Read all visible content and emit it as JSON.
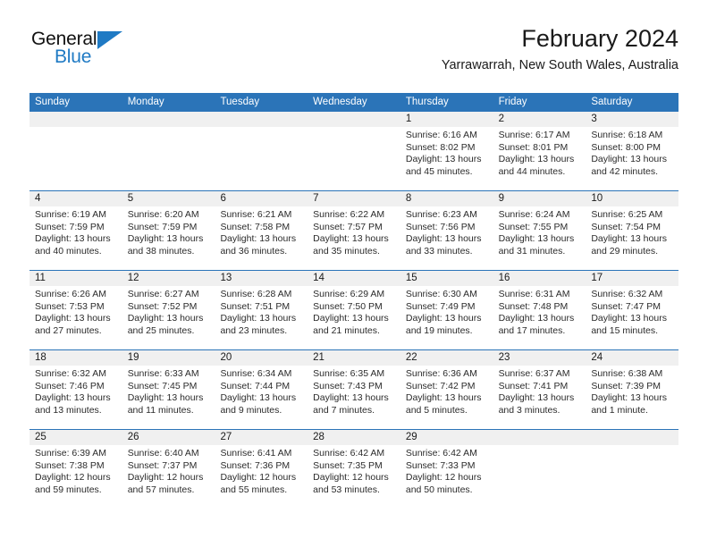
{
  "logo": {
    "word1": "General",
    "word2": "Blue",
    "blue": "#1f7ac4"
  },
  "header": {
    "title": "February 2024",
    "subtitle": "Yarrawarrah, New South Wales, Australia"
  },
  "theme": {
    "header_blue": "#2b74b8",
    "daynum_band": "#f0f0f0"
  },
  "calendar": {
    "weekday_headers": [
      "Sunday",
      "Monday",
      "Tuesday",
      "Wednesday",
      "Thursday",
      "Friday",
      "Saturday"
    ],
    "weeks": [
      [
        {
          "day": "",
          "lines": []
        },
        {
          "day": "",
          "lines": []
        },
        {
          "day": "",
          "lines": []
        },
        {
          "day": "",
          "lines": []
        },
        {
          "day": "1",
          "lines": [
            "Sunrise: 6:16 AM",
            "Sunset: 8:02 PM",
            "Daylight: 13 hours",
            "and 45 minutes."
          ]
        },
        {
          "day": "2",
          "lines": [
            "Sunrise: 6:17 AM",
            "Sunset: 8:01 PM",
            "Daylight: 13 hours",
            "and 44 minutes."
          ]
        },
        {
          "day": "3",
          "lines": [
            "Sunrise: 6:18 AM",
            "Sunset: 8:00 PM",
            "Daylight: 13 hours",
            "and 42 minutes."
          ]
        }
      ],
      [
        {
          "day": "4",
          "lines": [
            "Sunrise: 6:19 AM",
            "Sunset: 7:59 PM",
            "Daylight: 13 hours",
            "and 40 minutes."
          ]
        },
        {
          "day": "5",
          "lines": [
            "Sunrise: 6:20 AM",
            "Sunset: 7:59 PM",
            "Daylight: 13 hours",
            "and 38 minutes."
          ]
        },
        {
          "day": "6",
          "lines": [
            "Sunrise: 6:21 AM",
            "Sunset: 7:58 PM",
            "Daylight: 13 hours",
            "and 36 minutes."
          ]
        },
        {
          "day": "7",
          "lines": [
            "Sunrise: 6:22 AM",
            "Sunset: 7:57 PM",
            "Daylight: 13 hours",
            "and 35 minutes."
          ]
        },
        {
          "day": "8",
          "lines": [
            "Sunrise: 6:23 AM",
            "Sunset: 7:56 PM",
            "Daylight: 13 hours",
            "and 33 minutes."
          ]
        },
        {
          "day": "9",
          "lines": [
            "Sunrise: 6:24 AM",
            "Sunset: 7:55 PM",
            "Daylight: 13 hours",
            "and 31 minutes."
          ]
        },
        {
          "day": "10",
          "lines": [
            "Sunrise: 6:25 AM",
            "Sunset: 7:54 PM",
            "Daylight: 13 hours",
            "and 29 minutes."
          ]
        }
      ],
      [
        {
          "day": "11",
          "lines": [
            "Sunrise: 6:26 AM",
            "Sunset: 7:53 PM",
            "Daylight: 13 hours",
            "and 27 minutes."
          ]
        },
        {
          "day": "12",
          "lines": [
            "Sunrise: 6:27 AM",
            "Sunset: 7:52 PM",
            "Daylight: 13 hours",
            "and 25 minutes."
          ]
        },
        {
          "day": "13",
          "lines": [
            "Sunrise: 6:28 AM",
            "Sunset: 7:51 PM",
            "Daylight: 13 hours",
            "and 23 minutes."
          ]
        },
        {
          "day": "14",
          "lines": [
            "Sunrise: 6:29 AM",
            "Sunset: 7:50 PM",
            "Daylight: 13 hours",
            "and 21 minutes."
          ]
        },
        {
          "day": "15",
          "lines": [
            "Sunrise: 6:30 AM",
            "Sunset: 7:49 PM",
            "Daylight: 13 hours",
            "and 19 minutes."
          ]
        },
        {
          "day": "16",
          "lines": [
            "Sunrise: 6:31 AM",
            "Sunset: 7:48 PM",
            "Daylight: 13 hours",
            "and 17 minutes."
          ]
        },
        {
          "day": "17",
          "lines": [
            "Sunrise: 6:32 AM",
            "Sunset: 7:47 PM",
            "Daylight: 13 hours",
            "and 15 minutes."
          ]
        }
      ],
      [
        {
          "day": "18",
          "lines": [
            "Sunrise: 6:32 AM",
            "Sunset: 7:46 PM",
            "Daylight: 13 hours",
            "and 13 minutes."
          ]
        },
        {
          "day": "19",
          "lines": [
            "Sunrise: 6:33 AM",
            "Sunset: 7:45 PM",
            "Daylight: 13 hours",
            "and 11 minutes."
          ]
        },
        {
          "day": "20",
          "lines": [
            "Sunrise: 6:34 AM",
            "Sunset: 7:44 PM",
            "Daylight: 13 hours",
            "and 9 minutes."
          ]
        },
        {
          "day": "21",
          "lines": [
            "Sunrise: 6:35 AM",
            "Sunset: 7:43 PM",
            "Daylight: 13 hours",
            "and 7 minutes."
          ]
        },
        {
          "day": "22",
          "lines": [
            "Sunrise: 6:36 AM",
            "Sunset: 7:42 PM",
            "Daylight: 13 hours",
            "and 5 minutes."
          ]
        },
        {
          "day": "23",
          "lines": [
            "Sunrise: 6:37 AM",
            "Sunset: 7:41 PM",
            "Daylight: 13 hours",
            "and 3 minutes."
          ]
        },
        {
          "day": "24",
          "lines": [
            "Sunrise: 6:38 AM",
            "Sunset: 7:39 PM",
            "Daylight: 13 hours",
            "and 1 minute."
          ]
        }
      ],
      [
        {
          "day": "25",
          "lines": [
            "Sunrise: 6:39 AM",
            "Sunset: 7:38 PM",
            "Daylight: 12 hours",
            "and 59 minutes."
          ]
        },
        {
          "day": "26",
          "lines": [
            "Sunrise: 6:40 AM",
            "Sunset: 7:37 PM",
            "Daylight: 12 hours",
            "and 57 minutes."
          ]
        },
        {
          "day": "27",
          "lines": [
            "Sunrise: 6:41 AM",
            "Sunset: 7:36 PM",
            "Daylight: 12 hours",
            "and 55 minutes."
          ]
        },
        {
          "day": "28",
          "lines": [
            "Sunrise: 6:42 AM",
            "Sunset: 7:35 PM",
            "Daylight: 12 hours",
            "and 53 minutes."
          ]
        },
        {
          "day": "29",
          "lines": [
            "Sunrise: 6:42 AM",
            "Sunset: 7:33 PM",
            "Daylight: 12 hours",
            "and 50 minutes."
          ]
        },
        {
          "day": "",
          "lines": []
        },
        {
          "day": "",
          "lines": []
        }
      ]
    ]
  }
}
